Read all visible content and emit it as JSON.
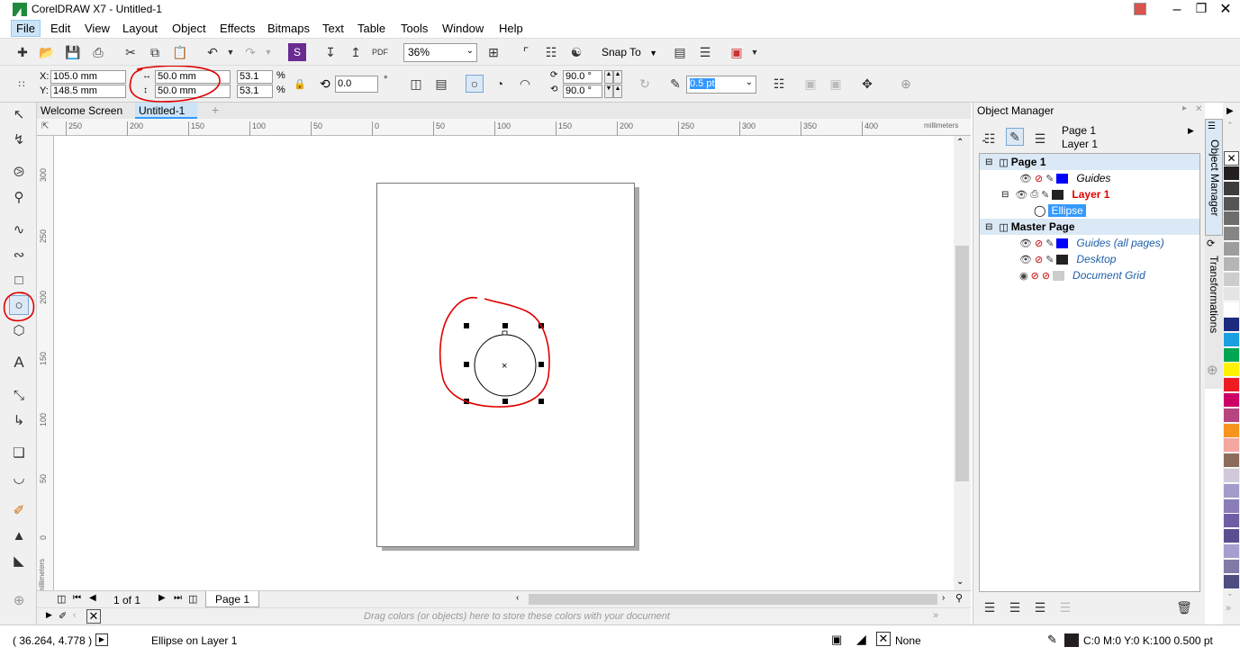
{
  "window": {
    "title": "CorelDRAW X7 - Untitled-1",
    "controls": [
      "minimize",
      "restore",
      "close"
    ]
  },
  "menu": [
    "File",
    "Edit",
    "View",
    "Layout",
    "Object",
    "Effects",
    "Bitmaps",
    "Text",
    "Table",
    "Tools",
    "Window",
    "Help"
  ],
  "toolbar": {
    "zoom": "36%",
    "snap_to": "Snap To"
  },
  "propbar": {
    "x_label": "X:",
    "x_value": "105.0 mm",
    "y_label": "Y:",
    "y_value": "148.5 mm",
    "width_value": "50.0 mm",
    "height_value": "50.0 mm",
    "scale_w": "53.1",
    "scale_h": "53.1",
    "percent": "%",
    "rotation": "0.0",
    "degree": "°",
    "start_angle": "90.0 °",
    "end_angle": "90.0 °",
    "outline_width": "0.5 pt"
  },
  "tabs": {
    "welcome": "Welcome Screen",
    "doc": "Untitled-1",
    "add": "+"
  },
  "hruler": {
    "ticks": [
      "250",
      "200",
      "150",
      "100",
      "50",
      "0",
      "50",
      "100",
      "150",
      "200",
      "250",
      "300",
      "350",
      "400"
    ],
    "units": "millimeters"
  },
  "vruler": {
    "ticks": [
      "300",
      "250",
      "200",
      "150",
      "100",
      "50",
      "0"
    ],
    "units": "millimeters"
  },
  "pagenav": {
    "count": "1 of 1",
    "page_tab": "Page 1"
  },
  "docpalette": {
    "hint": "Drag colors (or objects) here to store these colors with your document"
  },
  "objmgr": {
    "title": "Object Manager",
    "current_page": "Page 1",
    "current_layer": "Layer 1",
    "tree": [
      {
        "label": "Page 1",
        "kind": "page",
        "swatch": ""
      },
      {
        "label": "Guides",
        "kind": "layer",
        "swatch": "#0000ff"
      },
      {
        "label": "Layer 1",
        "kind": "active-layer",
        "swatch": "#222222"
      },
      {
        "label": "Ellipse",
        "kind": "object",
        "swatch": ""
      },
      {
        "label": "Master Page",
        "kind": "page",
        "swatch": ""
      },
      {
        "label": "Guides (all pages)",
        "kind": "layer",
        "swatch": "#0000ff"
      },
      {
        "label": "Desktop",
        "kind": "layer",
        "swatch": "#222222"
      },
      {
        "label": "Document Grid",
        "kind": "layer",
        "swatch": "#cccccc"
      }
    ]
  },
  "dockertabs": {
    "objmgr": "Object Manager",
    "transform": "Transformations"
  },
  "palette": [
    "#231f20",
    "#3d3d3d",
    "#555555",
    "#6d6d6d",
    "#858585",
    "#9d9d9d",
    "#b5b5b5",
    "#cdcdcd",
    "#e5e5e5",
    "#ffffff",
    "#1c2b7d",
    "#1a9fe0",
    "#00a651",
    "#fff200",
    "#ed1c24",
    "#cc0066",
    "#b5467f",
    "#f7941d",
    "#f4a6a0",
    "#8c6d5c",
    "#d2c8dc",
    "#a39bc9",
    "#8a7db8",
    "#6f5da5",
    "#5c4e90",
    "#a59fcf",
    "#807aa7",
    "#4d4d80"
  ],
  "status": {
    "coords": "( 36.264, 4.778 )",
    "info": "Ellipse on Layer 1",
    "fill": "None",
    "outline": "C:0 M:0 Y:0 K:100  0.500 pt"
  },
  "colors": {
    "annotation_red": "#e00000",
    "selection": "#3399ff",
    "tab_active": "#cce4f7"
  }
}
